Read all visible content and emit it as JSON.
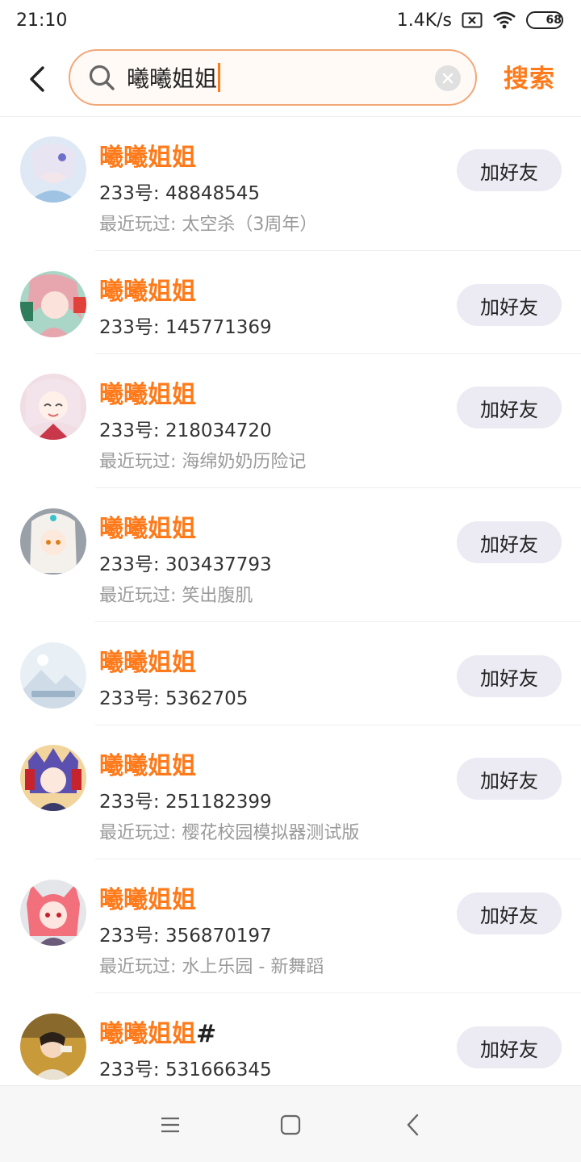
{
  "status_bar": {
    "time": "21:10",
    "network_speed": "1.4K/s",
    "battery_level": "68",
    "battery_fraction": 0.68,
    "icons": [
      "sim-x-icon",
      "wifi-icon",
      "battery-icon"
    ]
  },
  "search": {
    "query": "曦曦姐姐",
    "search_button": "搜索"
  },
  "results": [
    {
      "name": "曦曦姐姐",
      "name_suffix": "",
      "id_text": "233号: 48848545",
      "recent": "最近玩过: 太空杀（3周年）",
      "add_label": "加好友"
    },
    {
      "name": "曦曦姐姐",
      "name_suffix": "",
      "id_text": "233号: 145771369",
      "recent": "",
      "add_label": "加好友"
    },
    {
      "name": "曦曦姐姐",
      "name_suffix": "",
      "id_text": "233号: 218034720",
      "recent": "最近玩过: 海绵奶奶历险记",
      "add_label": "加好友"
    },
    {
      "name": "曦曦姐姐",
      "name_suffix": "",
      "id_text": "233号: 303437793",
      "recent": "最近玩过: 笑出腹肌",
      "add_label": "加好友"
    },
    {
      "name": "曦曦姐姐",
      "name_suffix": "",
      "id_text": "233号: 5362705",
      "recent": "",
      "add_label": "加好友"
    },
    {
      "name": "曦曦姐姐",
      "name_suffix": "",
      "id_text": "233号: 251182399",
      "recent": "最近玩过: 樱花校园模拟器测试版",
      "add_label": "加好友"
    },
    {
      "name": "曦曦姐姐",
      "name_suffix": "",
      "id_text": "233号: 356870197",
      "recent": "最近玩过: 水上乐园 - 新舞蹈",
      "add_label": "加好友"
    },
    {
      "name": "曦曦姐姐",
      "name_suffix": "#",
      "id_text": "233号: 531666345",
      "recent": "",
      "add_label": "加好友"
    }
  ],
  "nav_bar": {
    "icons": [
      "menu-icon",
      "home-square-icon",
      "back-triangle-icon"
    ]
  },
  "colors": {
    "accent": "#ff7a1a",
    "button_bg": "#ecebf3",
    "secondary_text": "#9a9a9a"
  }
}
